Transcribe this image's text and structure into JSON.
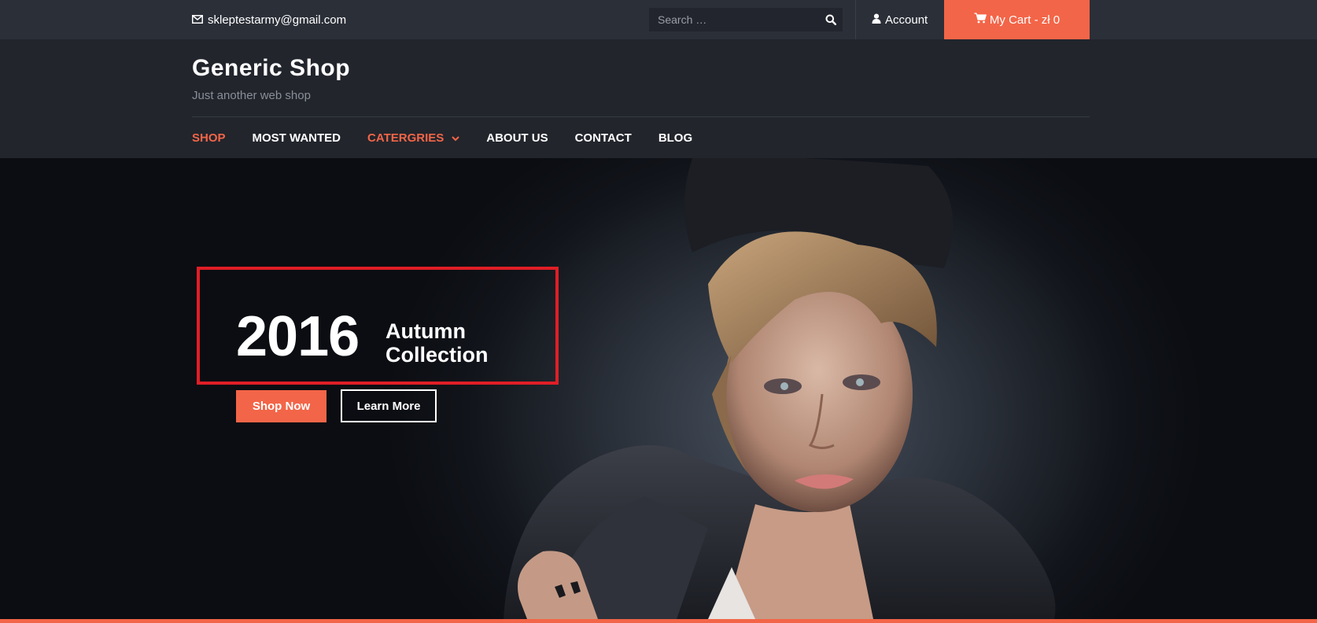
{
  "topbar": {
    "email": "skleptestarmy@gmail.com",
    "search_placeholder": "Search …",
    "account_label": "Account",
    "cart_label": "My Cart - zł 0"
  },
  "header": {
    "site_title": "Generic Shop",
    "tagline": "Just another web shop"
  },
  "nav": {
    "items": [
      {
        "label": "SHOP",
        "active": true
      },
      {
        "label": "MOST WANTED",
        "active": false
      },
      {
        "label": "CATERGRIES",
        "active": true,
        "dropdown": true
      },
      {
        "label": "ABOUT US",
        "active": false
      },
      {
        "label": "CONTACT",
        "active": false
      },
      {
        "label": "BLOG",
        "active": false
      }
    ]
  },
  "hero": {
    "year": "2016",
    "collection_line1": "Autumn",
    "collection_line2": "Collection",
    "shop_now": "Shop Now",
    "learn_more": "Learn More"
  },
  "colors": {
    "accent": "#f36548",
    "topbar_bg": "#2b2f38",
    "header_bg": "#22252c",
    "highlight_frame": "#e01e26"
  },
  "icons": [
    "envelope-icon",
    "search-icon",
    "user-icon",
    "cart-icon",
    "chevron-down-icon"
  ]
}
